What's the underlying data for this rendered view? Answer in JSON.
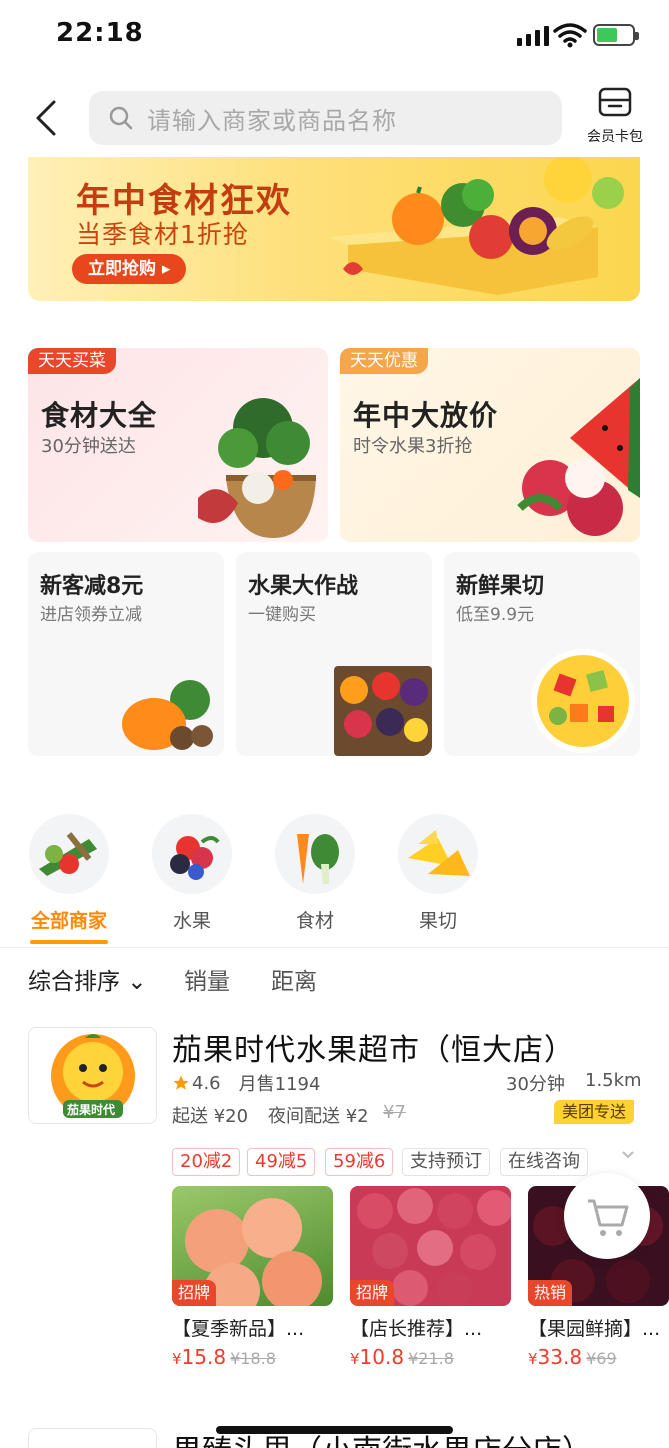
{
  "status": {
    "time": "22:18"
  },
  "search": {
    "placeholder": "请输入商家或商品名称"
  },
  "member_card": {
    "label": "会员卡包"
  },
  "banner": {
    "title": "年中食材狂欢",
    "subtitle": "当季食材1折抢",
    "button": "立即抢购 ▸"
  },
  "tiles": {
    "left": {
      "tag": "天天买菜",
      "title": "食材大全",
      "subtitle": "30分钟送达"
    },
    "right": {
      "tag": "天天优惠",
      "title": "年中大放价",
      "subtitle": "时令水果3折抢"
    }
  },
  "small_tiles": [
    {
      "title": "新客减8元",
      "subtitle": "进店领券立减"
    },
    {
      "title": "水果大作战",
      "subtitle": "一键购买"
    },
    {
      "title": "新鲜果切",
      "subtitle": "低至9.9元"
    }
  ],
  "categories": [
    {
      "name": "全部商家",
      "active": true
    },
    {
      "name": "水果",
      "active": false
    },
    {
      "name": "食材",
      "active": false
    },
    {
      "name": "果切",
      "active": false
    }
  ],
  "sort": {
    "items": [
      "综合排序 ⌄",
      "销量",
      "距离"
    ]
  },
  "store": {
    "name": "茄果时代水果超市（恒大店）",
    "rating": "4.6",
    "monthly_sales": "月售1194",
    "delivery_time": "30分钟",
    "distance": "1.5km",
    "min_order": "起送 ¥20",
    "night_fee": "夜间配送 ¥2",
    "night_fee_old": "¥7",
    "delivery_badge": "美团专送",
    "logo_text": "茄果时代",
    "tags": [
      "20减2",
      "49减5",
      "59减6",
      "支持预订",
      "在线咨询"
    ],
    "products": [
      {
        "badge": "招牌",
        "name": "【夏季新品】...",
        "price": "15.8",
        "old_price": "¥18.8"
      },
      {
        "badge": "招牌",
        "name": "【店长推荐】...",
        "price": "10.8",
        "old_price": "¥21.8"
      },
      {
        "badge": "热销",
        "name": "【果园鲜摘】...",
        "price": "33.8",
        "old_price": "¥69"
      }
    ]
  },
  "next_store": {
    "name": "果臻头里（小南街水果店分店）"
  },
  "colors": {
    "accent": "#ff9a00",
    "price": "#ef3b2a",
    "tag_left": "#e8472b",
    "tag_right": "#f3a64a"
  }
}
